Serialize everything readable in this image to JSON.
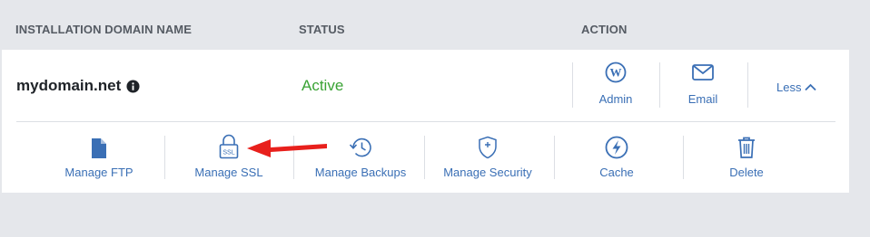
{
  "table_header": {
    "domain_col": "INSTALLATION DOMAIN NAME",
    "status_col": "STATUS",
    "action_col": "ACTION"
  },
  "row": {
    "domain": "mydomain.net",
    "status": "Active",
    "status_color": "#3aa335",
    "actions": [
      {
        "label": "Admin",
        "icon": "wordpress-icon"
      },
      {
        "label": "Email",
        "icon": "envelope-icon"
      }
    ],
    "toggle_label": "Less",
    "toggle_icon": "chevron-up-icon"
  },
  "tools": [
    {
      "label": "Manage FTP",
      "icon": "file-icon"
    },
    {
      "label": "Manage SSL",
      "icon": "ssl-lock-icon",
      "badge": "SSL"
    },
    {
      "label": "Manage Backups",
      "icon": "history-clock-icon"
    },
    {
      "label": "Manage Security",
      "icon": "shield-plus-icon"
    },
    {
      "label": "Cache",
      "icon": "lightning-circle-icon"
    },
    {
      "label": "Delete",
      "icon": "trash-icon"
    }
  ],
  "colors": {
    "link": "#3a6fb5",
    "annotation_arrow": "#e8201c",
    "background": "#e5e7eb"
  }
}
